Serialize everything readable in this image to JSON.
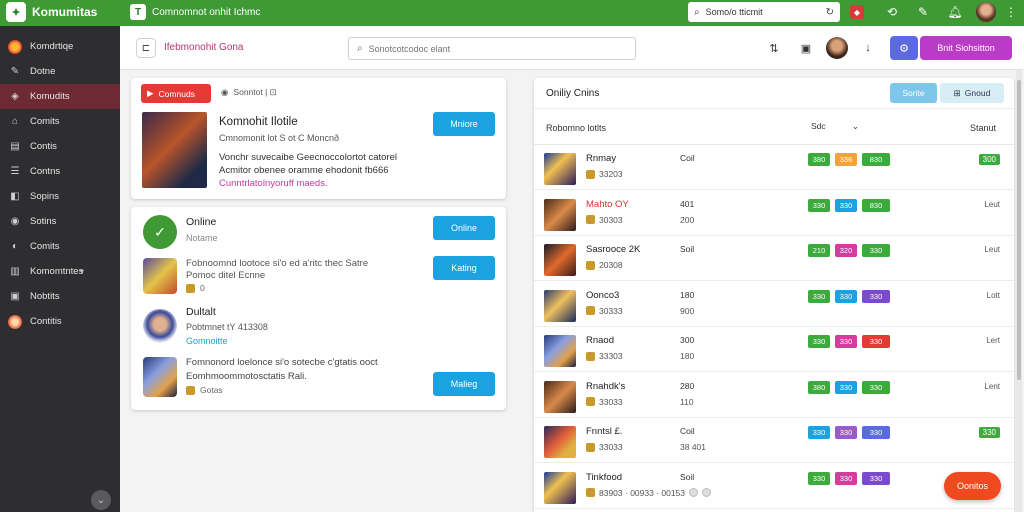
{
  "topbar": {
    "brand": "Komumitas",
    "title": "Comnomnot onhit Ichmc",
    "search_value": "Somo/o tticmit"
  },
  "sidebar": {
    "items": [
      {
        "label": "Komdrtiqe",
        "icon": "logo-icon"
      },
      {
        "label": "Dotne",
        "icon": "pencil-icon"
      },
      {
        "label": "Komudits",
        "icon": "game-icon",
        "active": true
      },
      {
        "label": "Comits",
        "icon": "home-icon"
      },
      {
        "label": "Contis",
        "icon": "edit-icon"
      },
      {
        "label": "Contns",
        "icon": "list-icon"
      },
      {
        "label": "Sopins",
        "icon": "tag-icon"
      },
      {
        "label": "Sotins",
        "icon": "gamepad-icon"
      },
      {
        "label": "Comits",
        "icon": "chat-icon"
      },
      {
        "label": "Komomtntes",
        "icon": "chart-icon",
        "has_chevron": true
      },
      {
        "label": "Nobtits",
        "icon": "doc-icon"
      },
      {
        "label": "Contitis",
        "icon": "fire-icon"
      }
    ]
  },
  "subheader": {
    "title": "Ifebmonohit Gona",
    "search_placeholder": "Sonotcotcodoc elant",
    "cta_label": "Bnit Siohsitton"
  },
  "card1": {
    "tag_label": "Comnuds",
    "section_label": "Sonntot | ⊡",
    "title": "Komnohit Ilotile",
    "subtitle": "Cmnomonit lot S ot C Moncnð",
    "desc1": "Vonchr suvecaibe Geecnoccolortot catorel",
    "desc2": "Acmitor obenee oramme ehodonit fb666",
    "desc3": "Cunntrlatolnyoruff maeds.",
    "button": "Mniore"
  },
  "card2": {
    "item1": {
      "title": "Online",
      "subtitle": "Notame",
      "button": "Online"
    },
    "item2": {
      "desc1": "Fobnoomnd lootoce si'o ed a'ritc thec Satre",
      "desc2": "Pomoc ditel Ecnne",
      "meta": "0",
      "button": "Kating"
    },
    "item3": {
      "title": "Dultalt",
      "subtitle": "Pobtmnet tY 413308",
      "link": "Gomnoitte"
    },
    "item4": {
      "desc1": "Fomnonord loelonce si'o sotecbe c'gtatis ooct",
      "desc2": "Eomhmoommotosctatis Rali.",
      "meta": "Gotas",
      "button": "Malieg"
    }
  },
  "right_panel": {
    "title": "Oniliy Cnins",
    "btn1": "Sorite",
    "btn2": "Gnoud",
    "col1": "Robomno lotlts",
    "filter": "Sdc",
    "col3": "Stanut",
    "rows": [
      {
        "name": "Rnmay",
        "score": "33203",
        "c2": "Coil",
        "c2b": "",
        "badges": [
          "380",
          "336",
          "830"
        ],
        "badge_colors": [
          "#3caa3c",
          "#f0a33a",
          "#3caa3c"
        ],
        "status": "300",
        "status_green": true
      },
      {
        "name": "Mahto OY",
        "name_red": true,
        "score": "30303",
        "c2": "401",
        "c2b": "200",
        "badges": [
          "330",
          "330",
          "830"
        ],
        "badge_colors": [
          "#3caa3c",
          "#1aa3e0",
          "#3caa3c"
        ],
        "status": "Leut",
        "status_green": false
      },
      {
        "name": "Sasrooce 2K",
        "score": "20308",
        "c2": "Soil",
        "c2b": "",
        "badges": [
          "210",
          "320",
          "330"
        ],
        "badge_colors": [
          "#3caa3c",
          "#d83a9e",
          "#3caa3c"
        ],
        "status": "Leut",
        "status_green": false
      },
      {
        "name": "Oonco3",
        "score": "30333",
        "c2": "180",
        "c2b": "900",
        "badges": [
          "330",
          "330",
          "330"
        ],
        "badge_colors": [
          "#3caa3c",
          "#1aa3e0",
          "#7a4ad0"
        ],
        "status": "Lott",
        "status_green": false
      },
      {
        "name": "Rnaod",
        "score": "33303",
        "c2": "300",
        "c2b": "180",
        "badges": [
          "330",
          "330",
          "330"
        ],
        "badge_colors": [
          "#3caa3c",
          "#d83a9e",
          "#e53935"
        ],
        "status": "Lert",
        "status_green": false
      },
      {
        "name": "Rnahdk's",
        "score": "33033",
        "c2": "280",
        "c2b": "110",
        "badges": [
          "380",
          "330",
          "330"
        ],
        "badge_colors": [
          "#3caa3c",
          "#1aa3e0",
          "#3caa3c"
        ],
        "status": "Lent",
        "status_green": false
      },
      {
        "name": "Fnntsl £.",
        "score": "33033",
        "c2": "Coil",
        "c2b": "38 401",
        "badges": [
          "330",
          "330",
          "330"
        ],
        "badge_colors": [
          "#1aa3e0",
          "#9a5ac8",
          "#5b6ae0"
        ],
        "status": "330",
        "status_green": true
      },
      {
        "name": "Tinkfood",
        "score": "83903 · 00933 · 00153",
        "c2": "Soil",
        "c2b": "",
        "badges": [
          "330",
          "330",
          "330"
        ],
        "badge_colors": [
          "#3caa3c",
          "#d83a9e",
          "#7a4ad0"
        ],
        "status": "",
        "status_green": false
      }
    ]
  },
  "fab": {
    "label": "Oonitos"
  }
}
